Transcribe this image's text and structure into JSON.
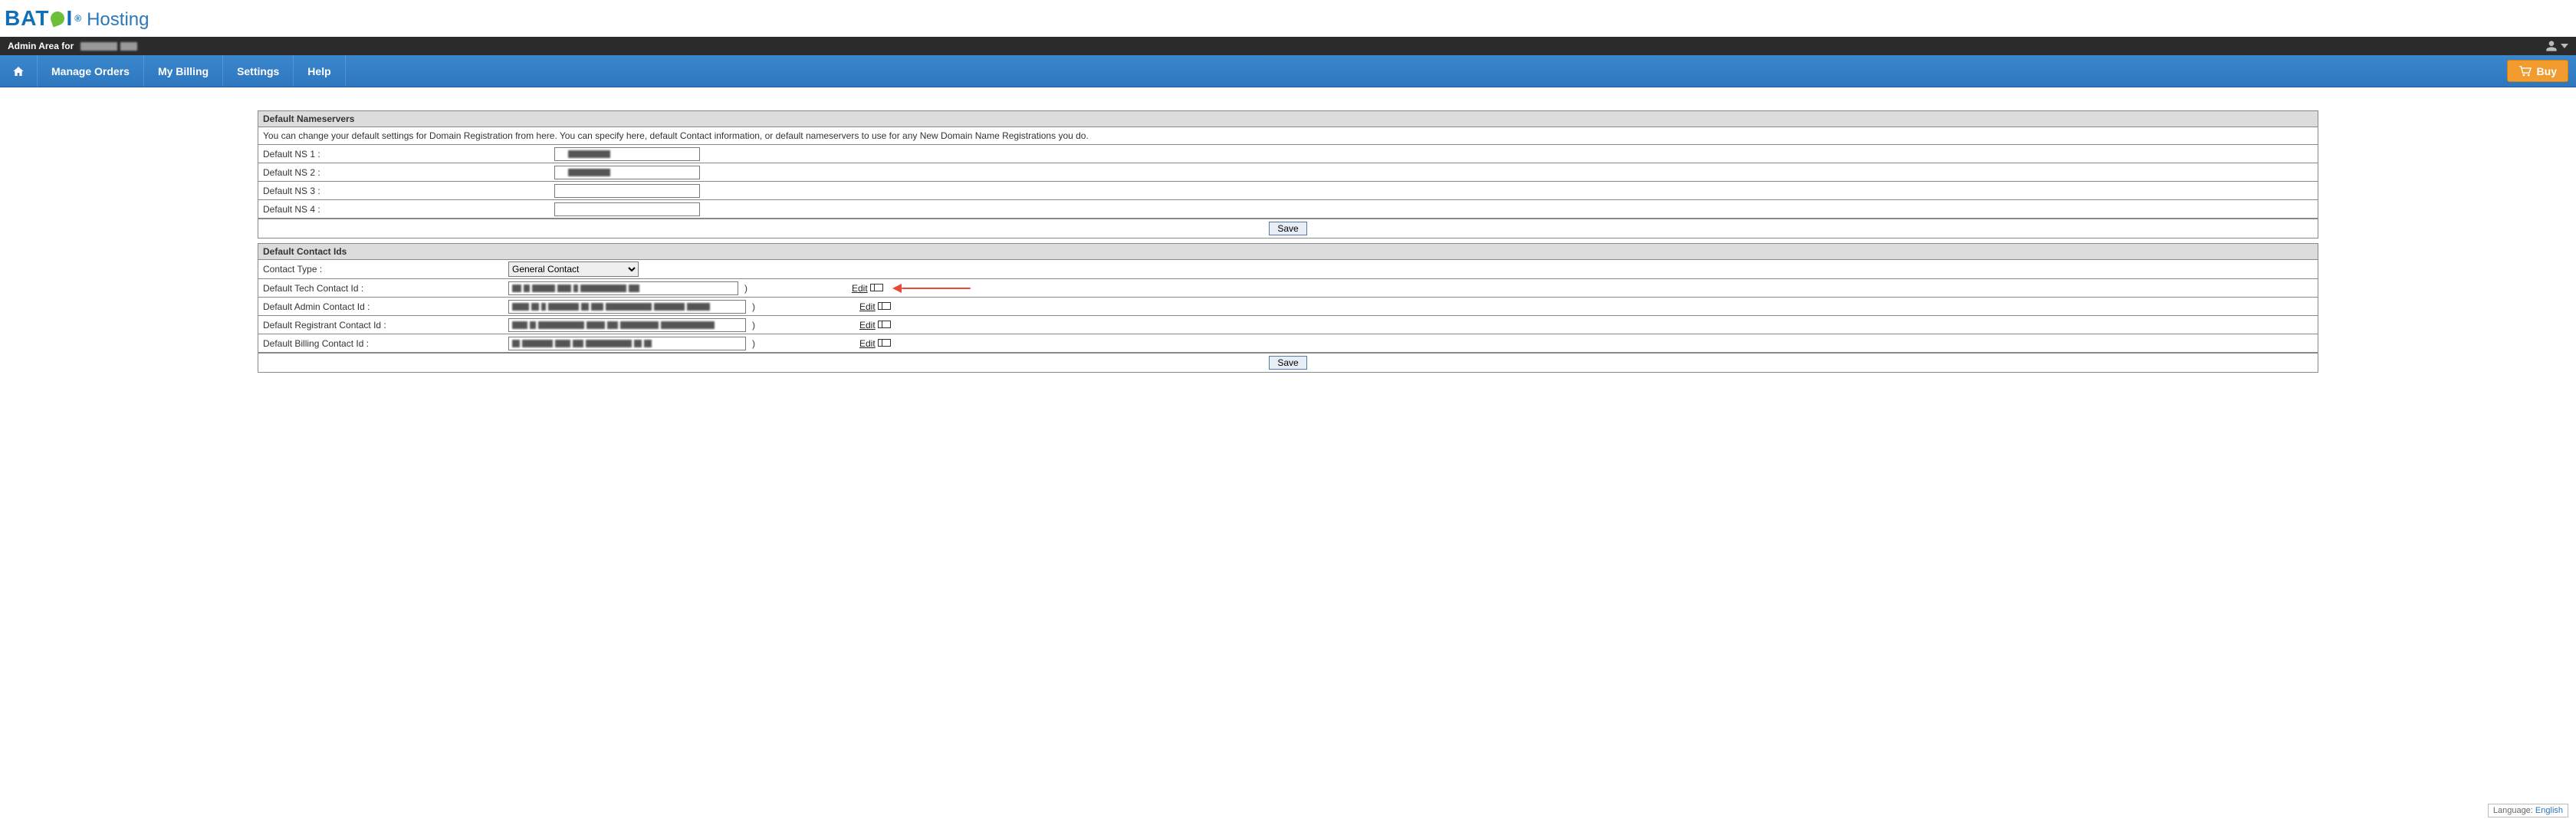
{
  "brand": {
    "name": "BATOI",
    "sub": "Hosting"
  },
  "adminBar": {
    "prefix": "Admin Area for"
  },
  "nav": {
    "items": [
      {
        "label": "Manage Orders"
      },
      {
        "label": "My Billing"
      },
      {
        "label": "Settings"
      },
      {
        "label": "Help"
      }
    ],
    "buy": "Buy"
  },
  "sections": {
    "ns": {
      "title": "Default Nameservers",
      "desc": "You can change your default settings for Domain Registration from here. You can specify here, default Contact information, or default nameservers to use for any New Domain Name Registrations you do.",
      "rows": [
        {
          "label": "Default NS 1 :",
          "value": ""
        },
        {
          "label": "Default NS 2 :",
          "value": ""
        },
        {
          "label": "Default NS 3 :",
          "value": ""
        },
        {
          "label": "Default NS 4 :",
          "value": ""
        }
      ],
      "save": "Save"
    },
    "contacts": {
      "title": "Default Contact Ids",
      "typeLabel": "Contact Type :",
      "typeValue": "General Contact",
      "rows": [
        {
          "label": "Default Tech Contact Id :",
          "edit": "Edit",
          "arrow": true
        },
        {
          "label": "Default Admin Contact Id :",
          "edit": "Edit"
        },
        {
          "label": "Default Registrant Contact Id :",
          "edit": "Edit"
        },
        {
          "label": "Default Billing Contact Id :",
          "edit": "Edit"
        }
      ],
      "save": "Save"
    }
  },
  "footer": {
    "langLabel": "Language:",
    "langValue": "English"
  }
}
